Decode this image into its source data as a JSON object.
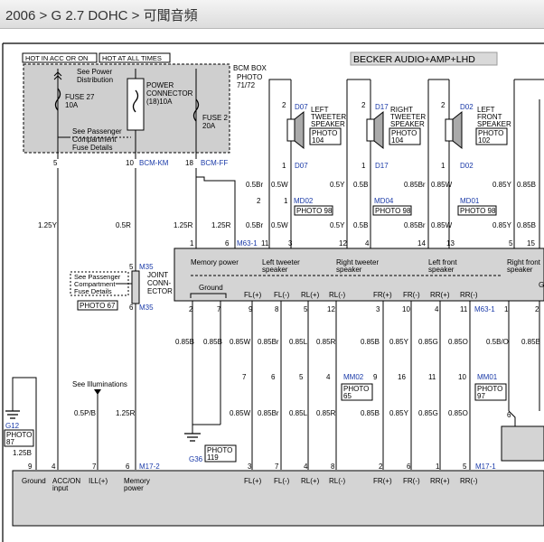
{
  "breadcrumb": {
    "year": "2006",
    "sep": " > ",
    "engine": "G 2.7 DOHC",
    "page": "可聞音頻"
  },
  "header": {
    "hot_acc": "HOT IN ACC OR ON",
    "hot_all": "HOT AT ALL TIMES",
    "bcm_box": "BCM BOX",
    "bcm_photo1": "PHOTO",
    "bcm_photo2": "71/72",
    "system_title": "BECKER AUDIO+AMP+LHD"
  },
  "fusebox": {
    "see_power1": "See Power",
    "see_power2": "Distribution",
    "fuse27a": "FUSE 27",
    "fuse27b": "10A",
    "see_pass1": "See Passenger",
    "see_pass2": "Compartment",
    "see_pass3": "Fuse Details",
    "power_conn1": "POWER",
    "power_conn2": "CONNECTOR",
    "power_conn3": "(18)10A",
    "fuse2a": "FUSE 2",
    "fuse2b": "20A",
    "pin5": "5",
    "pin10": "10",
    "bcm_km": "BCM-KM",
    "pin18": "18",
    "bcm_ff": "BCM-FF"
  },
  "speakers": {
    "lt_conn": "D07",
    "lt_l1": "LEFT",
    "lt_l2": "TWEETER",
    "lt_l3": "SPEAKER",
    "lt_p1": "PHOTO",
    "lt_p2": "104",
    "rt_conn": "D17",
    "rt_l1": "RIGHT",
    "rt_l2": "TWEETER",
    "rt_l3": "SPEAKER",
    "rt_p1": "PHOTO",
    "rt_p2": "104",
    "lf_conn": "D02",
    "lf_l1": "LEFT",
    "lf_l2": "FRONT",
    "lf_l3": "SPEAKER",
    "lf_p1": "PHOTO",
    "lf_p2": "102",
    "pin1": "1",
    "pin2": "2"
  },
  "wires": {
    "w_125y": "1.25Y",
    "w_05r": "0.5R",
    "w_125r": "1.25R",
    "w_05br": "0.5Br",
    "w_05w": "0.5W",
    "w_05y": "0.5Y",
    "w_05b": "0.5B",
    "w_085br": "0.85Br",
    "w_085w": "0.85W",
    "w_085y": "0.85Y",
    "w_085b": "0.85B",
    "w_085r": "0.85R",
    "w_085l": "0.85L",
    "w_085g": "0.85G",
    "w_085o": "0.85O",
    "w_05bo": "0.5B/O",
    "w_05pb": "0.5P/B",
    "w_125b": "1.25B"
  },
  "connectors": {
    "md02": "MD02",
    "md04": "MD04",
    "md01": "MD01",
    "photo98": "PHOTO 98",
    "m631": "M63-1",
    "m35": "M35",
    "mm02": "MM02",
    "mm01": "MM01",
    "photo": "PHOTO",
    "p65": "65",
    "p97": "97",
    "m172": "M17-2",
    "m171": "M17-1",
    "g36": "G36",
    "p119": "119",
    "g12": "G12",
    "p87": "87",
    "photo67": "PHOTO 67"
  },
  "joint": {
    "see1": "See Passenger",
    "see2": "Compartment",
    "see3": "Fuse Details",
    "j1": "JOINT",
    "j2": "CONN-",
    "j3": "ECTOR",
    "pin5": "5",
    "pin6": "6"
  },
  "amp": {
    "memory_power": "Memory power",
    "left_tweeter1": "Left tweeter",
    "left_tweeter2": "speaker",
    "right_tweeter1": "Right tweeter",
    "right_tweeter2": "speaker",
    "left_front1": "Left front",
    "left_front2": "speaker",
    "right_front1": "Right front",
    "right_front2": "speaker",
    "ground": "Ground",
    "fl_pos": "FL(+)",
    "fl_neg": "FL(-)",
    "rl_pos": "RL(+)",
    "rl_neg": "RL(-)",
    "fr_pos": "FR(+)",
    "fr_neg": "FR(-)",
    "rr_pos": "RR(+)",
    "rr_neg": "RR(-)",
    "cut_g": "G"
  },
  "head_unit": {
    "ground": "Ground",
    "acc_on1": "ACC/ON",
    "acc_on2": "input",
    "ill": "ILL(+)",
    "mem1": "Memory",
    "mem2": "power",
    "fl_pos": "FL(+)",
    "fl_neg": "FL(-)",
    "rl_pos": "RL(+)",
    "rl_neg": "RL(-)",
    "fr_pos": "FR(+)",
    "fr_neg": "FR(-)",
    "rr_pos": "RR(+)",
    "rr_neg": "RR(-)"
  },
  "misc": {
    "see_illum": "See Illuminations"
  }
}
